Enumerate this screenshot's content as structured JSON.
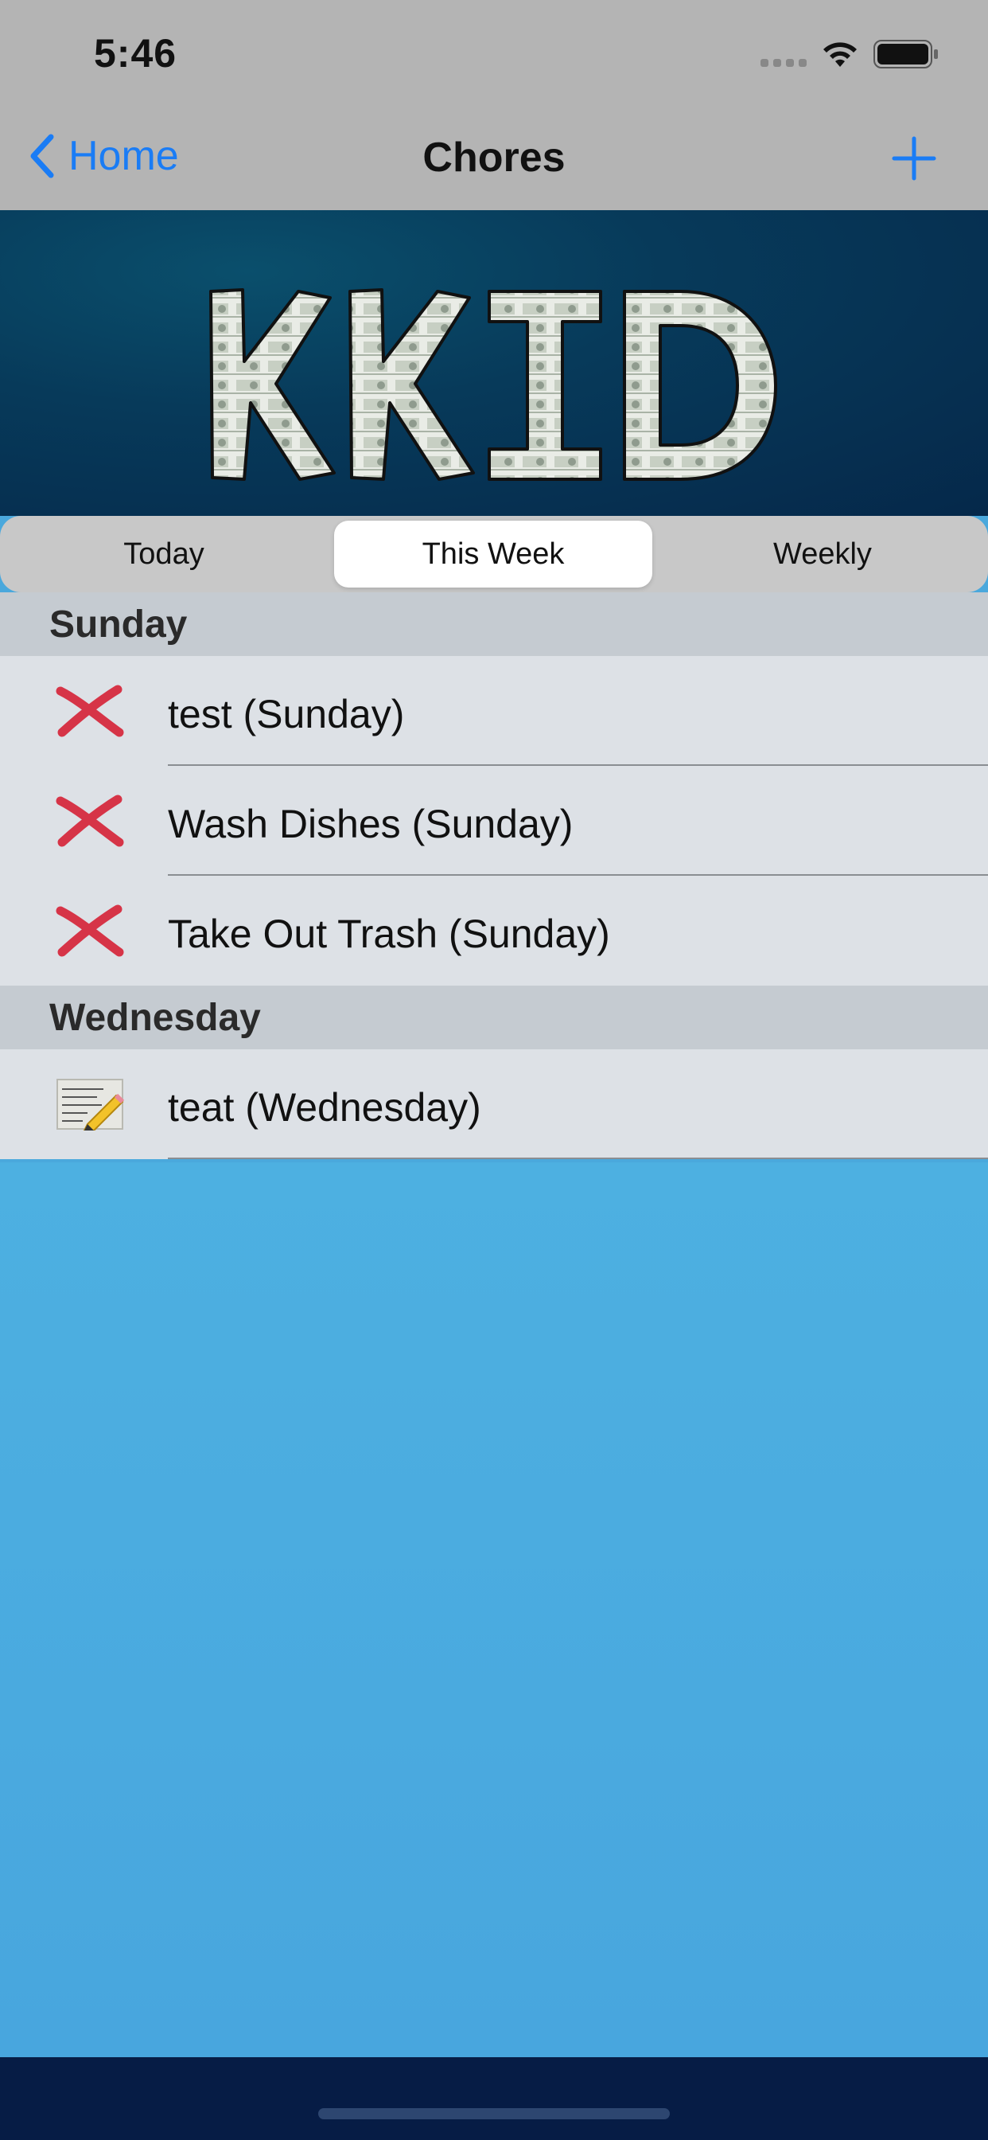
{
  "status_bar": {
    "time": "5:46"
  },
  "nav": {
    "back_label": "Home",
    "title": "Chores"
  },
  "banner": {
    "logo_text": "KKID"
  },
  "segments": [
    {
      "label": "Today",
      "selected": false
    },
    {
      "label": "This Week",
      "selected": true
    },
    {
      "label": "Weekly",
      "selected": false
    }
  ],
  "sections": [
    {
      "title": "Sunday",
      "rows": [
        {
          "label": "test (Sunday)",
          "icon": "red-x-icon"
        },
        {
          "label": "Wash Dishes (Sunday)",
          "icon": "red-x-icon"
        },
        {
          "label": "Take Out Trash (Sunday)",
          "icon": "red-x-icon"
        }
      ]
    },
    {
      "title": "Wednesday",
      "rows": [
        {
          "label": "teat (Wednesday)",
          "icon": "memo-pencil-icon"
        }
      ]
    }
  ],
  "colors": {
    "accent": "#1a7cf5",
    "nav_bg": "#b4b4b4",
    "banner_bg": "#05284a",
    "x_red": "#d63447",
    "page_bg": "#4aa8dc"
  }
}
